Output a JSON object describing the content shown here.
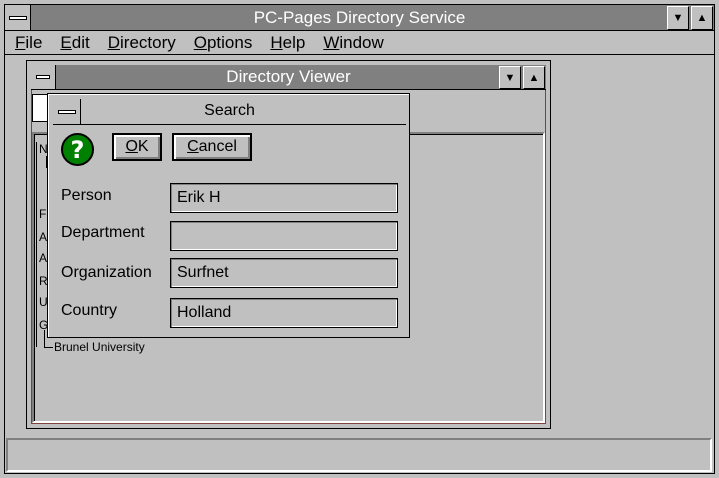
{
  "app": {
    "title": "PC-Pages Directory Service",
    "menu": [
      "File",
      "Edit",
      "Directory",
      "Options",
      "Help",
      "Window"
    ]
  },
  "doc_window": {
    "title": "Directory Viewer",
    "tree": {
      "items": [
        "N",
        "F",
        "A",
        "A",
        "R",
        "U",
        "G"
      ],
      "leaf": "Brunel University"
    }
  },
  "dialog": {
    "title": "Search",
    "ok_label": "OK",
    "cancel_label": "Cancel",
    "fields": [
      {
        "label": "Person",
        "value": "Erik H"
      },
      {
        "label": "Department",
        "value": ""
      },
      {
        "label": "Organization",
        "value": "Surfnet"
      },
      {
        "label": "Country",
        "value": "Holland"
      }
    ]
  },
  "colors": {
    "titlebar": "#808080",
    "face": "#c0c0c0",
    "question_icon": "#008000"
  },
  "icons": [
    "system-menu-icon",
    "minimize-icon",
    "maximize-icon",
    "question-icon",
    "document-icon"
  ]
}
